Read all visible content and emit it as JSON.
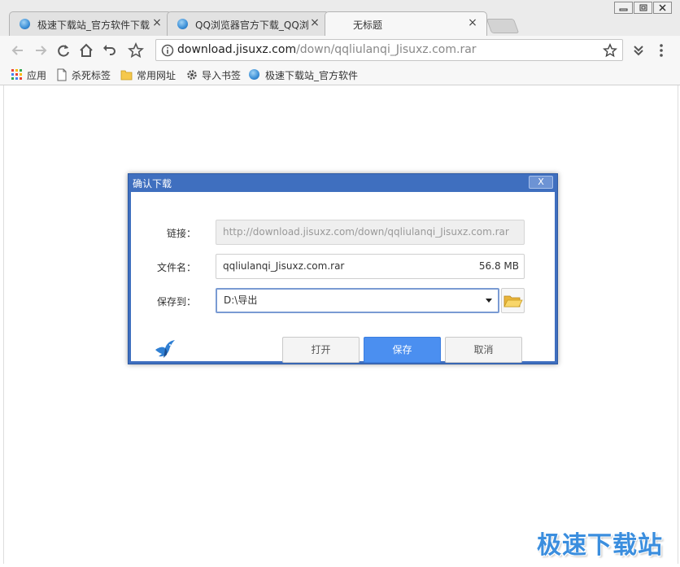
{
  "tabs": [
    {
      "title": "极速下载站_官方软件下载",
      "active": false
    },
    {
      "title": "QQ浏览器官方下载_QQ浏",
      "active": false
    },
    {
      "title": "无标题",
      "active": true
    }
  ],
  "tab_close_glyph": "×",
  "toolbar": {
    "url_host": "download.jisuxz.com",
    "url_path": "/down/qqliulanqi_Jisuxz.com.rar"
  },
  "bookmarks": [
    {
      "label": "应用",
      "icon": "apps-grid-icon"
    },
    {
      "label": "杀死标签",
      "icon": "page-icon"
    },
    {
      "label": "常用网址",
      "icon": "folder-icon"
    },
    {
      "label": "导入书签",
      "icon": "gear-icon"
    },
    {
      "label": "极速下载站_官方软件",
      "icon": "site-favicon-icon"
    }
  ],
  "dialog": {
    "title": "确认下载",
    "close_glyph": "X",
    "link_label": "链接：",
    "link_value": "http://download.jisuxz.com/down/qqliulanqi_Jisuxz.com.rar",
    "filename_label": "文件名：",
    "filename_value": "qqliulanqi_Jisuxz.com.rar",
    "filesize": "56.8 MB",
    "saveto_label": "保存到：",
    "saveto_value": "D:\\导出",
    "buttons": {
      "open": "打开",
      "save": "保存",
      "cancel": "取消"
    }
  },
  "watermark": "极速下载站",
  "colors": {
    "dialog_frame": "#3f6fbf",
    "primary_button": "#4b8ff0",
    "watermark": "#3b8ede"
  }
}
